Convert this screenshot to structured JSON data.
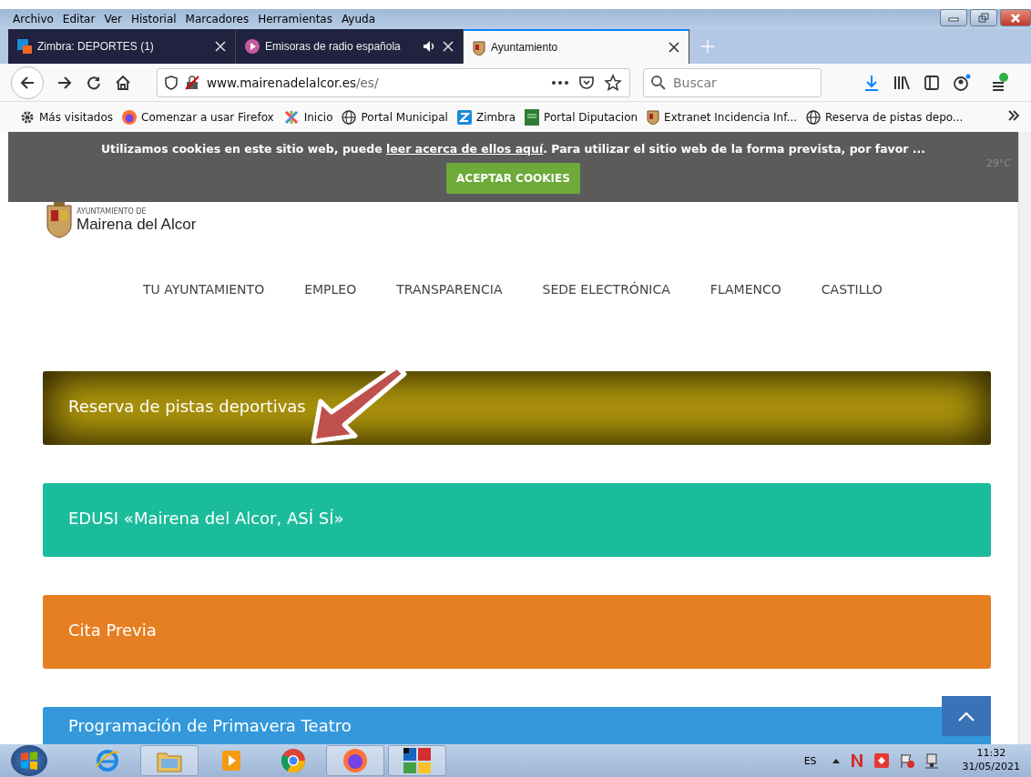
{
  "menu_bar": [
    "Archivo",
    "Editar",
    "Ver",
    "Historial",
    "Marcadores",
    "Herramientas",
    "Ayuda"
  ],
  "tabs": [
    {
      "title": "Zimbra: DEPORTES (1)",
      "selected": false,
      "kind": "mail",
      "audio": false
    },
    {
      "title": "Emisoras de radio española",
      "selected": false,
      "kind": "radio",
      "audio": true
    },
    {
      "title": "Ayuntamiento",
      "selected": true,
      "kind": "crest",
      "audio": false
    }
  ],
  "url": {
    "domain": "www.mairenadelalcor.es",
    "path": "/es/"
  },
  "search": {
    "placeholder": "Buscar"
  },
  "bookmarks": [
    {
      "label": "Más visitados",
      "kind": "gear"
    },
    {
      "label": "Comenzar a usar Firefox",
      "kind": "firefox"
    },
    {
      "label": "Inicio",
      "kind": "joomla"
    },
    {
      "label": "Portal Municipal",
      "kind": "globe"
    },
    {
      "label": "Zimbra",
      "kind": "z"
    },
    {
      "label": "Portal Diputacion",
      "kind": "green"
    },
    {
      "label": "Extranet Incidencia Inf...",
      "kind": "crest"
    },
    {
      "label": "Reserva de pistas depo...",
      "kind": "globe"
    }
  ],
  "cookie_bar": {
    "text_before": "Utilizamos cookies en este sitio web, puede ",
    "link": "leer acerca de ellos aquí",
    "text_after": ". Para utilizar el sitio web de la forma prevista, por favor ...",
    "button": "ACEPTAR COOKIES"
  },
  "weather": "29°C",
  "logo": {
    "small": "AYUNTAMIENTO DE",
    "name": "Mairena del Alcor"
  },
  "nav": [
    "TU AYUNTAMIENTO",
    "EMPLEO",
    "TRANSPARENCIA",
    "SEDE ELECTRÓNICA",
    "FLAMENCO",
    "CASTILLO"
  ],
  "cards": [
    {
      "title": "Reserva de pistas deportivas",
      "color": "#b39a0c",
      "kind": "glow"
    },
    {
      "title": "EDUSI «Mairena del Alcor, ASÍ SÍ»",
      "color": "#1bbc9b",
      "kind": "flat"
    },
    {
      "title": "Cita Previa",
      "color": "#e67e22",
      "kind": "flat"
    },
    {
      "title": "Programación de Primavera Teatro",
      "color": "#3498db",
      "kind": "flat"
    }
  ],
  "taskbar": {
    "language": "ES",
    "time": "11:32",
    "date": "31/05/2021"
  }
}
